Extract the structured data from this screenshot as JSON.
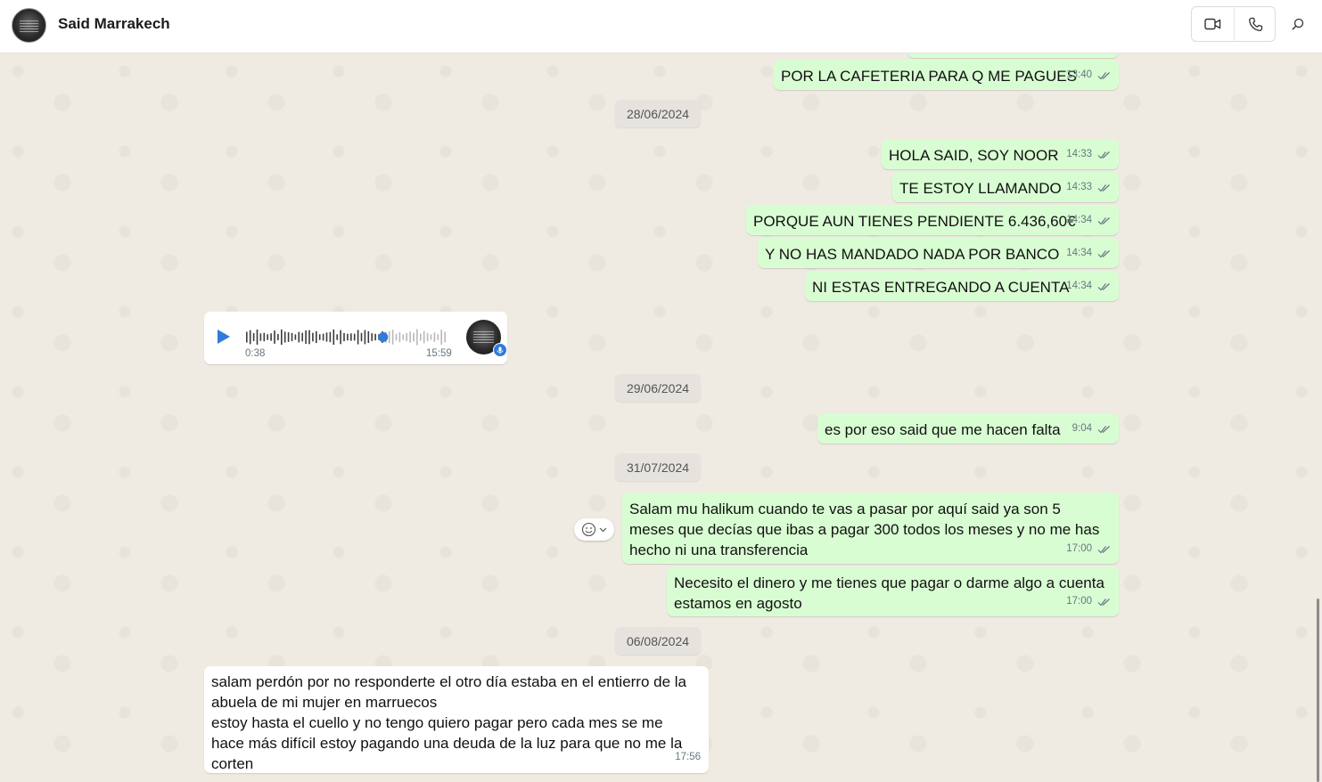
{
  "header": {
    "contact_name": "Said Marrakech",
    "video_icon": "video-call-icon",
    "voice_icon": "voice-call-icon",
    "search_icon": "search-icon"
  },
  "messages": [
    {
      "id": "m1",
      "dir": "out",
      "text": "POR LA CAFETERIA PARA Q ME PAGUES",
      "time": "13:40"
    },
    {
      "id": "d1",
      "type": "date",
      "text": "28/06/2024"
    },
    {
      "id": "m2",
      "dir": "out",
      "text": "HOLA SAID, SOY NOOR",
      "time": "14:33"
    },
    {
      "id": "m3",
      "dir": "out",
      "text": "TE ESTOY LLAMANDO",
      "time": "14:33"
    },
    {
      "id": "m4",
      "dir": "out",
      "text": "PORQUE AUN TIENES PENDIENTE 6.436,60€",
      "time": "14:34"
    },
    {
      "id": "m5",
      "dir": "out",
      "text": "Y NO HAS MANDADO NADA POR BANCO",
      "time": "14:34"
    },
    {
      "id": "m6",
      "dir": "out",
      "text": "NI ESTAS ENTREGANDO A CUENTA",
      "time": "14:34"
    },
    {
      "id": "v1",
      "dir": "in",
      "type": "voice",
      "duration": "0:38",
      "time": "15:59",
      "progress": 0.68
    },
    {
      "id": "d2",
      "type": "date",
      "text": "29/06/2024"
    },
    {
      "id": "m7",
      "dir": "out",
      "text": "es por eso said que me hacen falta",
      "time": "9:04"
    },
    {
      "id": "d3",
      "type": "date",
      "text": "31/07/2024"
    },
    {
      "id": "m8",
      "dir": "out",
      "text": "Salam mu halikum cuando te vas a pasar por aquí said ya son 5 meses que decías que ibas a pagar 300 todos los meses y no me has hecho ni una transferencia",
      "time": "17:00"
    },
    {
      "id": "m9",
      "dir": "out",
      "text": "Necesito el dinero y me tienes que pagar o darme algo a cuenta estamos en agosto",
      "time": "17:00"
    },
    {
      "id": "d4",
      "type": "date",
      "text": "06/08/2024"
    },
    {
      "id": "m10",
      "dir": "in",
      "text": "salam  perdón por no responderte el otro día estaba en el entierro de la abuela de mi mujer en marruecos\nestoy hasta el cuello y no tengo quiero pagar pero cada mes se me hace más difícil estoy pagando una deuda de la luz para que no me la corten",
      "time": "17:56"
    }
  ],
  "colors": {
    "outgoing": "#d9fdd3",
    "incoming": "#ffffff",
    "tick": "#667781",
    "accent": "#2f7bd8"
  }
}
